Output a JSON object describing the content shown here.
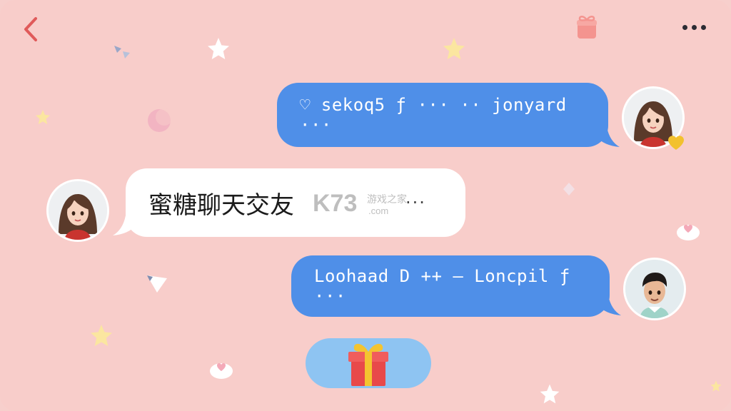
{
  "header": {
    "back_icon": "chevron-left-icon",
    "gift_icon": "gift-icon",
    "more_icon": "more-horizontal-icon"
  },
  "messages": [
    {
      "side": "right",
      "text": "♡ sekoq5 ƒ ··· ·· jonyard ···",
      "avatar": "girl-avatar",
      "bubble_color": "#4f8fe8"
    },
    {
      "side": "left",
      "text": "蜜糖聊天交友",
      "suffix": "···",
      "avatar": "girl-avatar",
      "bubble_color": "#ffffff"
    },
    {
      "side": "right",
      "text": "Loohaad D ++ — Loncpil ƒ ···",
      "avatar": "boy-avatar",
      "bubble_color": "#4f8fe8"
    }
  ],
  "watermark": {
    "brand": "K73",
    "sub": "游戏之家",
    "domain": ".com"
  },
  "gift_button": {
    "icon": "gift-box-icon",
    "color": "#8ec4f2"
  },
  "colors": {
    "background": "#f8cdca",
    "accent": "#e05a5a",
    "blue": "#4f8fe8"
  }
}
